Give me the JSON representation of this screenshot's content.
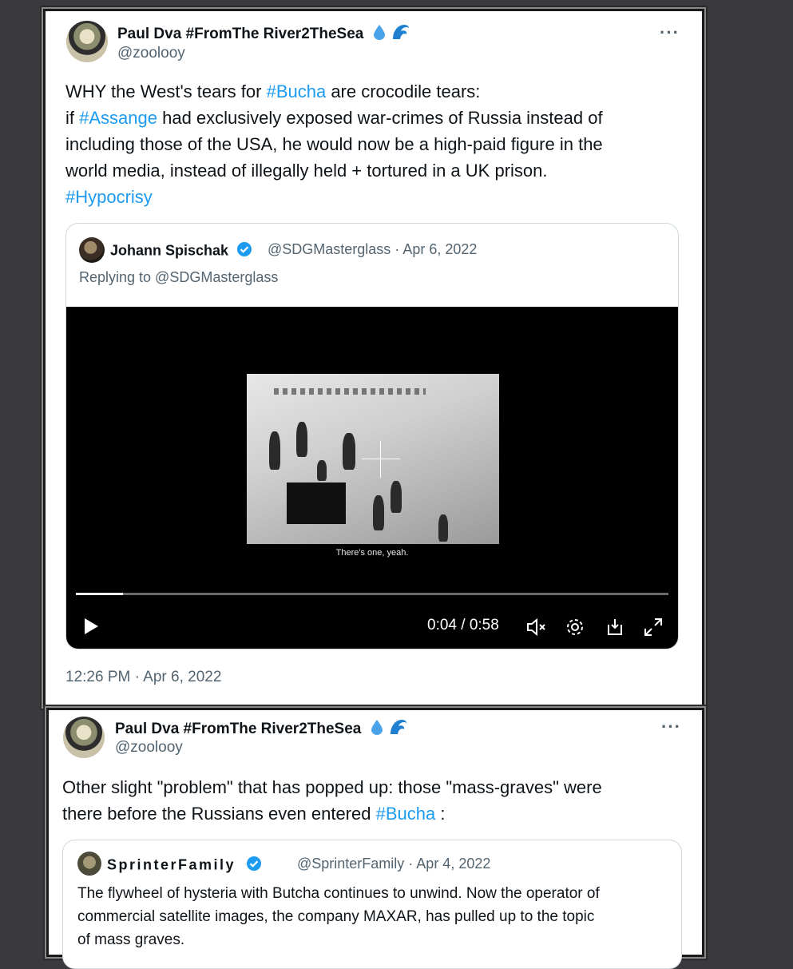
{
  "tweet1": {
    "author_name": "Paul Dva #FromThe River2TheSea",
    "author_handle": "@zoolooy",
    "more_label": "···",
    "text": {
      "l1_a": "WHY the West's tears for ",
      "l1_tag": "#Bucha",
      "l1_b": " are crocodile tears:",
      "l2_a": "if ",
      "l2_tag": "#Assange",
      "l2_b": " had exclusively exposed war-crimes of Russia instead of",
      "l3": "including those of the USA, he would now be a high-paid figure in the",
      "l4": "world media, instead of illegally held + tortured in a UK prison.",
      "l5_tag": "#Hypocrisy"
    },
    "quote": {
      "name": "Johann Spischak",
      "handle_date": "@SDGMasterglass · Apr 6, 2022",
      "replying": "Replying to @SDGMasterglass",
      "video": {
        "subtitle": "There's one, yeah.",
        "time": "0:04 / 0:58",
        "progress": 0.079
      }
    },
    "timestamp": "12:26 PM · Apr 6, 2022"
  },
  "tweet2": {
    "author_name": "Paul Dva #FromThe River2TheSea",
    "author_handle": "@zoolooy",
    "more_label": "···",
    "text": {
      "l1": "Other slight \"problem\" that has popped up: those \"mass-graves\" were",
      "l2_a": "there before the Russians even entered ",
      "l2_tag": "#Bucha",
      "l2_b": " :"
    },
    "quote": {
      "name": "SprinterFamily",
      "handle_date": "@SprinterFamily · Apr 4, 2022",
      "l1": "The flywheel of hysteria with Butcha continues to unwind. Now the operator of",
      "l2": "commercial satellite images, the company MAXAR, has pulled up to the topic",
      "l3": "of mass graves."
    }
  },
  "colors": {
    "link": "#1d9bf0",
    "muted": "#536471",
    "verified": "#1d9bf0"
  },
  "icons": [
    "droplet-icon",
    "wave-icon",
    "verified-icon",
    "play-icon",
    "mute-icon",
    "settings-icon",
    "pip-icon",
    "fullscreen-icon"
  ]
}
